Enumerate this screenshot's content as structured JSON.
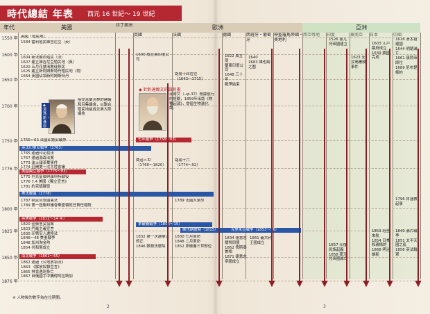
{
  "title": {
    "main": "時代總結 年表",
    "range": "西元 16 世紀～ 19 世紀"
  },
  "headers": {
    "year": "年代",
    "america": "美國",
    "latin": "拉丁美洲",
    "europe": "歐洲",
    "asia": "亞洲",
    "sub": {
      "uk": "英國",
      "france": "法國",
      "germany": "德國",
      "italy": "義大利",
      "spain": "西班牙・葡萄牙",
      "roman": "神聖羅馬帝國・奧地利",
      "westasia": "西亞等地",
      "china": "中國",
      "india": "印度",
      "eastsouth": "東南亞",
      "japan": "日本"
    }
  },
  "years": [
    "1550 年",
    "1600 年",
    "1650 年",
    "1700 年",
    "1750 年",
    "1776 年",
    "1800 年",
    "1825 年",
    "1850 年",
    "1876 年"
  ],
  "america_text": [
    {
      "label": "英國「殖民地」",
      "value": "1584 雷利殖民維吉尼亞（英）"
    },
    {
      "label": "",
      "value": "1604 新法蘭西殖民（法）\n1607 建立維吉尼亞殖民地（英）\n1620 五月花號清教徒移民\n1625 建立新阿姆斯特丹殖民地（荷）\n1664 英國佔領新阿姆斯特丹"
    },
    {
      "label": "",
      "value": "接受富蘭克林的建議和召集議會，以聯合殖民地組成北美大陸議會"
    },
    {
      "label": "",
      "value": "1755～63 法國印第安戰爭"
    },
    {
      "label": "",
      "value": "1765 通過印花稅法\n1767 通過湯森法案\n1773 波士頓茶葉事件\n1774 召開第一次大陸會議"
    },
    {
      "label": "",
      "value": "1775 列克星頓與康科特戰役\n1776 7.4 美國《獨立宣言》\n1781 約克鎮戰役"
    },
    {
      "label": "",
      "value": "1787 制定合眾國憲法\n1789 第一屆聯邦議會華盛頓就任首任總統"
    },
    {
      "label": "",
      "value": "1820 密蘇里妥協案\n1823 門羅主義宣言\n1830 印第安人遷移法\n1846～48 美墨戰爭\n1848 加州淘金熱\n1854 共和黨成立"
    },
    {
      "label": "",
      "value": "1862 通過《公地放領法》\n1863 《解放奴隸宣言》\n1865 林肯遇刺身亡\n1867 自俄國手中購得阿拉斯加"
    }
  ],
  "bands": [
    {
      "label": "英法印第安戰爭（1763）",
      "color": "#2a56a6"
    },
    {
      "label": "美國獨立戰爭（1775～83）",
      "color": "#b52831"
    },
    {
      "label": "美法聯盟（1778）",
      "color": "#2a56a6"
    },
    {
      "label": "英美戰爭（1812～14 年）",
      "color": "#b52831"
    },
    {
      "label": "南北戰爭（1861～65）",
      "color": "#b52831"
    },
    {
      "label": "七年戰爭（1756～63）",
      "color": "#b52831"
    },
    {
      "label": "拿破崙戰爭（1804～15）",
      "color": "#2a56a6"
    },
    {
      "label": "維也納體制（1815）",
      "color": "#2a56a6"
    },
    {
      "label": "克里米亞戰爭（1853～56）",
      "color": "#2a56a6"
    }
  ],
  "franklin": {
    "tag": "◆ 湯瑪斯・潘恩",
    "caption": "接受富蘭克林的建議和召集議會"
  },
  "darwin": {
    "tag": "◆ 針對達爾文的諷刺畫",
    "caption": "達爾文（→p.37）根據航行的經驗，1859年出版《物種起源》，提倡生物進化論。"
  },
  "europe_text": [
    {
      "key": "uk",
      "value": "1600 成立東印度公司"
    },
    {
      "key": "france",
      "value": "路易十四在位\n（1643～1715）"
    },
    {
      "key": "spain",
      "value": "1622 成立荷\n蘭東印度公司\n1648 三十年\n戰爭結束"
    },
    {
      "key": "westasia",
      "value": "1640 \n1683 維也納之圍"
    },
    {
      "key": "uk2",
      "value": "喬治三世\n（1760～1820）"
    },
    {
      "key": "france2",
      "value": "路易十六\n（1774～92）"
    },
    {
      "key": "germany2",
      "value": "1789 法國大革命"
    },
    {
      "key": "uk3",
      "value": "1832 第一次選舉法修正\n1846 穀物法廢除"
    },
    {
      "key": "france3",
      "value": "1830 七月革命\n1848 二月革命\n1852 拿破崙三世即位"
    },
    {
      "key": "germany3",
      "value": "1834 德意志關稅同盟\n1862 俾斯麥首相\n1871 德意志帝國成立"
    },
    {
      "key": "italy3",
      "value": "1861 義大利王國成立"
    }
  ],
  "asia_text": [
    {
      "key": "china",
      "value": "1616 清太祖建國\n1644 明朝滅亡\n1661 康熙帝即位\n1689 尼布楚條約"
    },
    {
      "key": "india",
      "value": "1526 蒙兀兒帝國建立"
    },
    {
      "key": "eastsouth",
      "value": "1623 安汶島屠殺事件"
    },
    {
      "key": "japan",
      "value": "1603 江戶幕府成立\n1639 鎖國完成"
    },
    {
      "key": "china2",
      "value": "1796 白蓮教起事"
    },
    {
      "key": "china3",
      "value": "1840 鴉片戰爭\n1851 太平天國之亂\n1856 英法聯軍"
    },
    {
      "key": "japan3",
      "value": "1853 培里來航\n1854 日美和親條約\n1868 明治維新"
    },
    {
      "key": "india3",
      "value": "1857 印度民族起義\n1858 蒙兀兒帝國滅亡"
    }
  ],
  "footnote": "※ 人物後的數字為在位期間。",
  "page_left": "2",
  "page_right": "3"
}
